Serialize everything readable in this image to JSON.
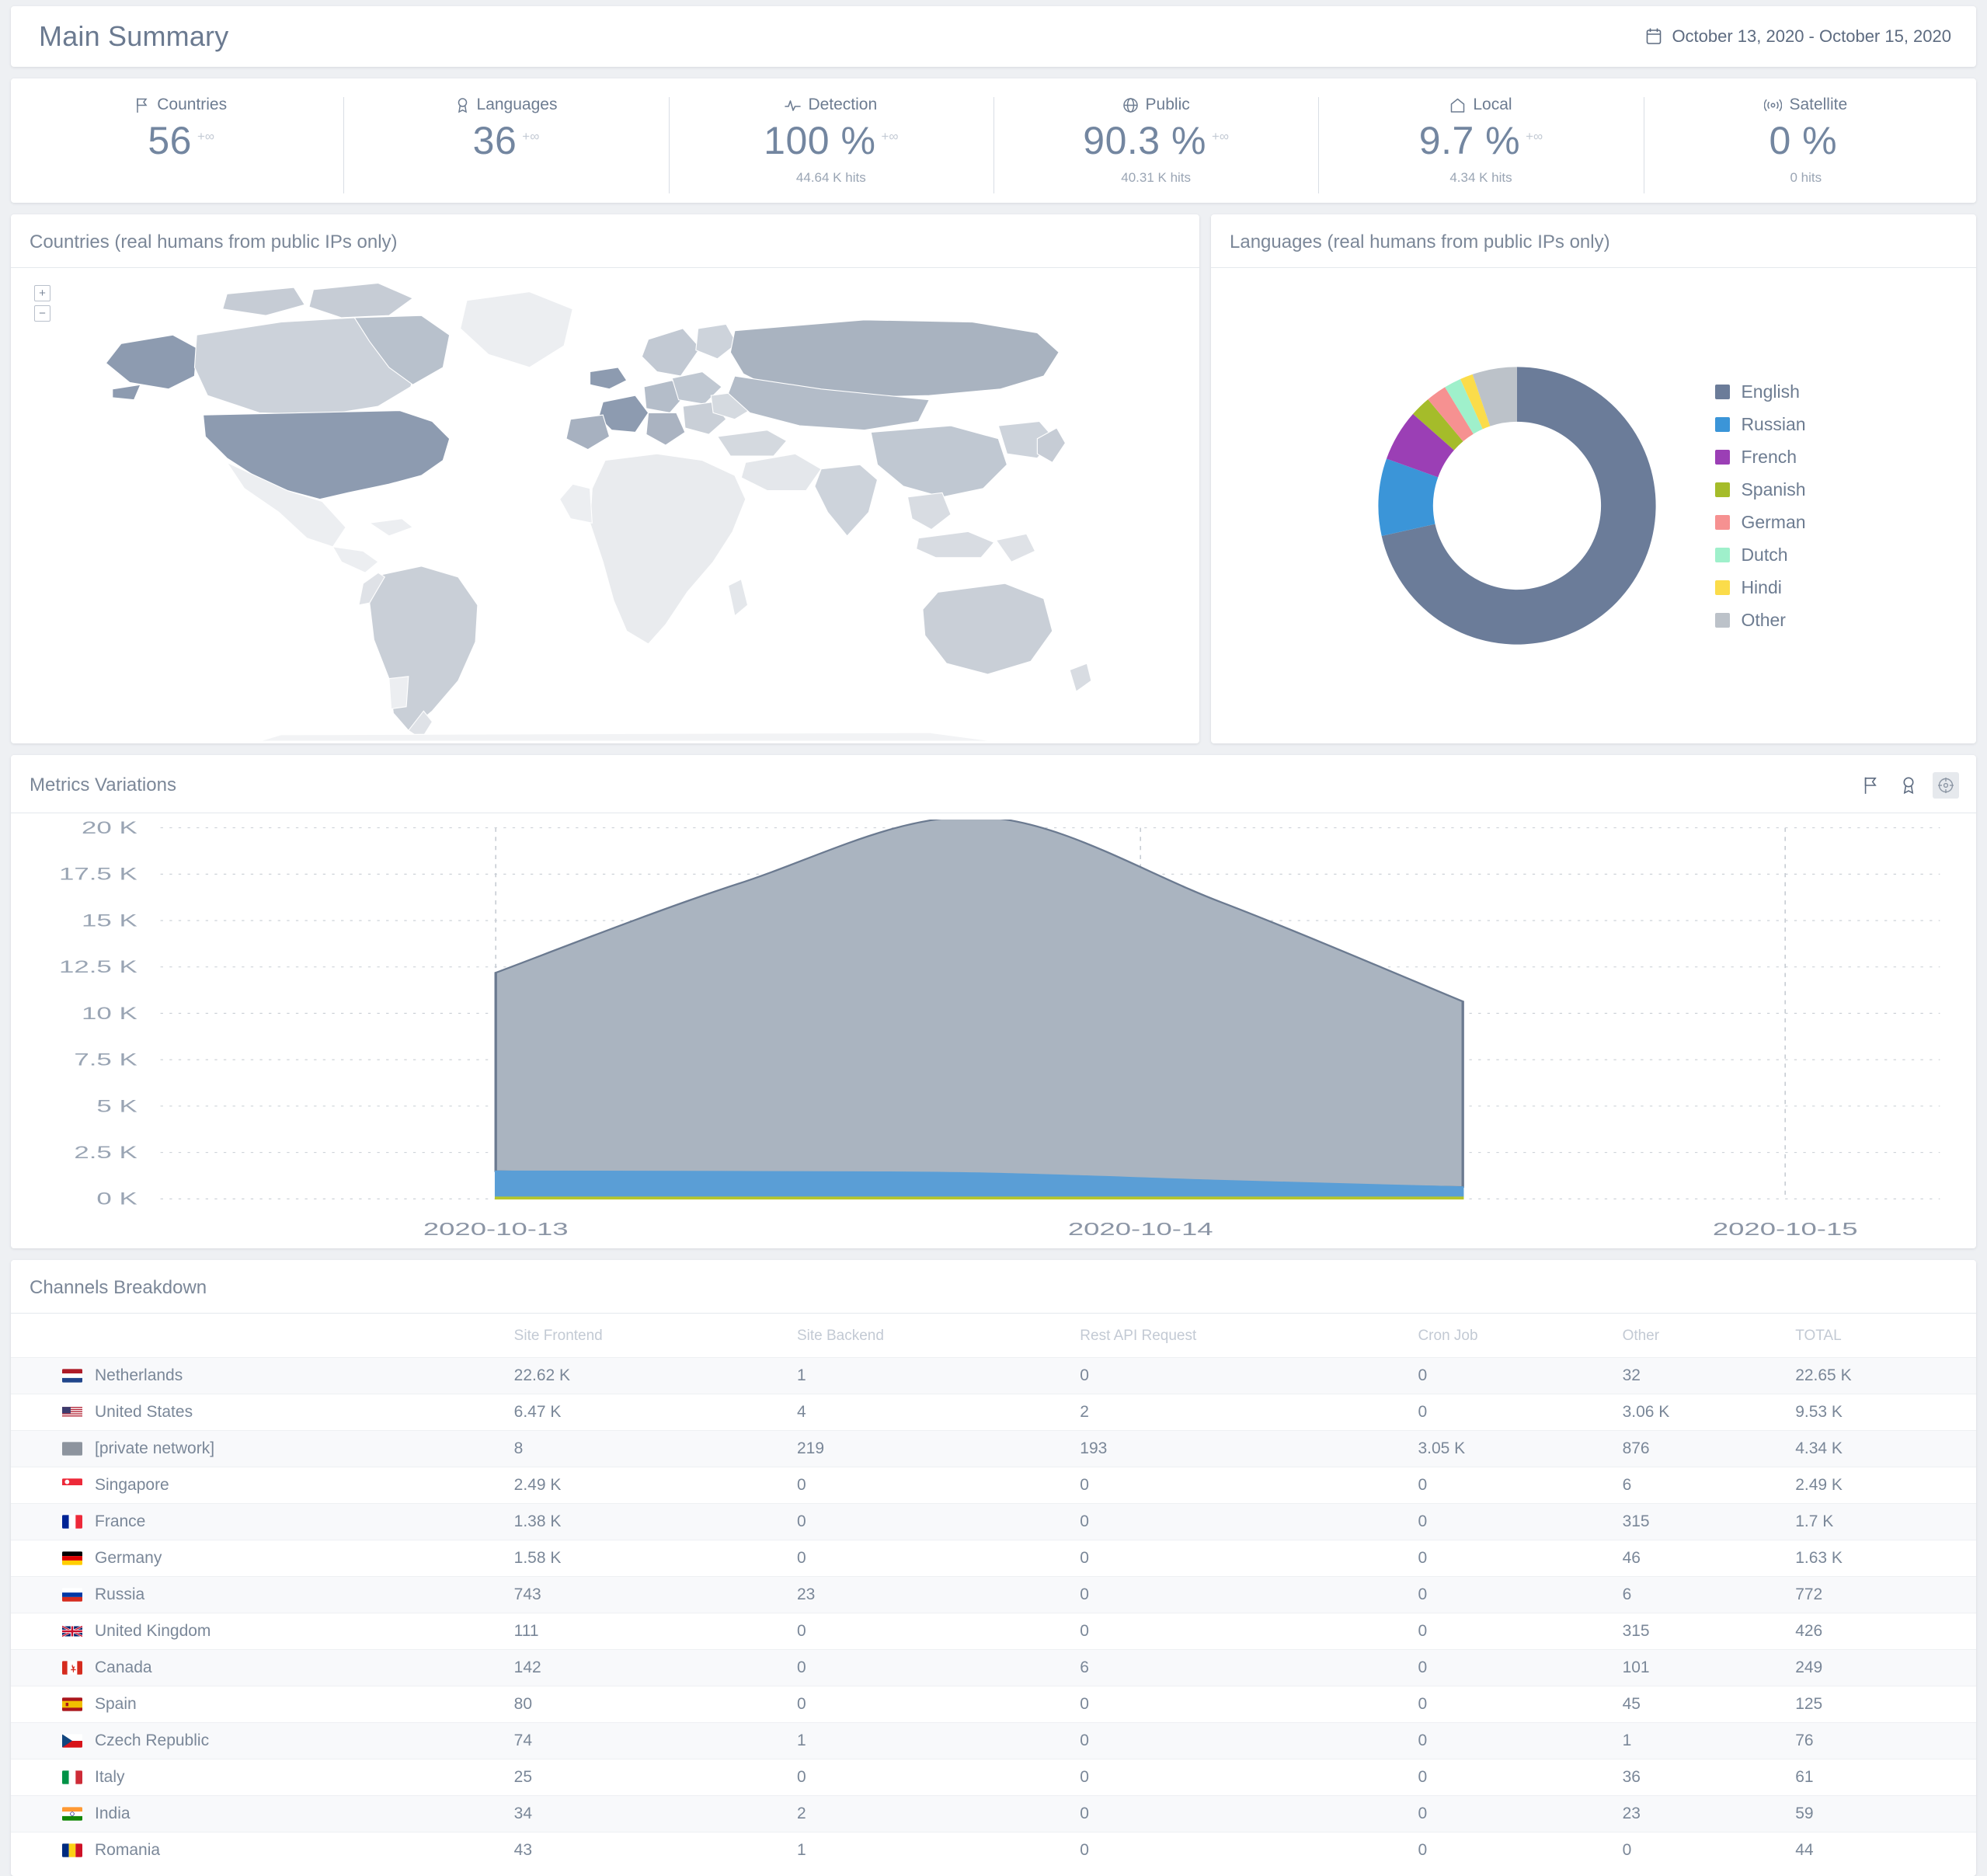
{
  "header": {
    "title": "Main Summary",
    "date_range": "October 13, 2020 - October 15, 2020",
    "calendar_icon": "calendar-icon"
  },
  "kpis": [
    {
      "icon": "flag-icon",
      "label": "Countries",
      "value": "56",
      "delta": "+∞",
      "sub": ""
    },
    {
      "icon": "award-icon",
      "label": "Languages",
      "value": "36",
      "delta": "+∞",
      "sub": ""
    },
    {
      "icon": "activity-icon",
      "label": "Detection",
      "value": "100 %",
      "delta": "+∞",
      "sub": "44.64 K hits"
    },
    {
      "icon": "globe-icon",
      "label": "Public",
      "value": "90.3 %",
      "delta": "+∞",
      "sub": "40.31 K hits"
    },
    {
      "icon": "home-icon",
      "label": "Local",
      "value": "9.7 %",
      "delta": "+∞",
      "sub": "4.34 K hits"
    },
    {
      "icon": "satellite-icon",
      "label": "Satellite",
      "value": "0 %",
      "delta": "",
      "sub": "0  hits"
    }
  ],
  "map_panel": {
    "title": "Countries (real humans from public IPs only)",
    "zoom_in_label": "+",
    "zoom_out_label": "−"
  },
  "languages_panel": {
    "title": "Languages (real humans from public IPs only)"
  },
  "metrics_panel": {
    "title": "Metrics Variations",
    "tools": [
      {
        "name": "flag-icon",
        "active": false
      },
      {
        "name": "award-icon",
        "active": false
      },
      {
        "name": "target-icon",
        "active": true
      }
    ]
  },
  "table_panel": {
    "title": "Channels Breakdown",
    "columns": [
      "",
      "Site Frontend",
      "Site Backend",
      "Rest API Request",
      "Cron Job",
      "Other",
      "TOTAL"
    ],
    "rows": [
      {
        "country": "Netherlands",
        "flag": "nl",
        "site_frontend": "22.62 K",
        "site_backend": "1",
        "rest_api": "0",
        "cron_job": "0",
        "other": "32",
        "total": "22.65 K"
      },
      {
        "country": "United States",
        "flag": "us",
        "site_frontend": "6.47 K",
        "site_backend": "4",
        "rest_api": "2",
        "cron_job": "0",
        "other": "3.06 K",
        "total": "9.53 K"
      },
      {
        "country": "[private network]",
        "flag": "private",
        "site_frontend": "8",
        "site_backend": "219",
        "rest_api": "193",
        "cron_job": "3.05 K",
        "other": "876",
        "total": "4.34 K"
      },
      {
        "country": "Singapore",
        "flag": "sg",
        "site_frontend": "2.49 K",
        "site_backend": "0",
        "rest_api": "0",
        "cron_job": "0",
        "other": "6",
        "total": "2.49 K"
      },
      {
        "country": "France",
        "flag": "fr",
        "site_frontend": "1.38 K",
        "site_backend": "0",
        "rest_api": "0",
        "cron_job": "0",
        "other": "315",
        "total": "1.7 K"
      },
      {
        "country": "Germany",
        "flag": "de",
        "site_frontend": "1.58 K",
        "site_backend": "0",
        "rest_api": "0",
        "cron_job": "0",
        "other": "46",
        "total": "1.63 K"
      },
      {
        "country": "Russia",
        "flag": "ru",
        "site_frontend": "743",
        "site_backend": "23",
        "rest_api": "0",
        "cron_job": "0",
        "other": "6",
        "total": "772"
      },
      {
        "country": "United Kingdom",
        "flag": "gb",
        "site_frontend": "111",
        "site_backend": "0",
        "rest_api": "0",
        "cron_job": "0",
        "other": "315",
        "total": "426"
      },
      {
        "country": "Canada",
        "flag": "ca",
        "site_frontend": "142",
        "site_backend": "0",
        "rest_api": "6",
        "cron_job": "0",
        "other": "101",
        "total": "249"
      },
      {
        "country": "Spain",
        "flag": "es",
        "site_frontend": "80",
        "site_backend": "0",
        "rest_api": "0",
        "cron_job": "0",
        "other": "45",
        "total": "125"
      },
      {
        "country": "Czech Republic",
        "flag": "cz",
        "site_frontend": "74",
        "site_backend": "1",
        "rest_api": "0",
        "cron_job": "0",
        "other": "1",
        "total": "76"
      },
      {
        "country": "Italy",
        "flag": "it",
        "site_frontend": "25",
        "site_backend": "0",
        "rest_api": "0",
        "cron_job": "0",
        "other": "36",
        "total": "61"
      },
      {
        "country": "India",
        "flag": "in",
        "site_frontend": "34",
        "site_backend": "2",
        "rest_api": "0",
        "cron_job": "0",
        "other": "23",
        "total": "59"
      },
      {
        "country": "Romania",
        "flag": "ro",
        "site_frontend": "43",
        "site_backend": "1",
        "rest_api": "0",
        "cron_job": "0",
        "other": "0",
        "total": "44"
      }
    ]
  },
  "chart_data": [
    {
      "type": "pie",
      "title": "Languages (real humans from public IPs only)",
      "legend_position": "right",
      "categories": [
        "English",
        "Russian",
        "French",
        "Spanish",
        "German",
        "Dutch",
        "Hindi",
        "Other"
      ],
      "values": [
        71.5,
        9.0,
        6.0,
        2.4,
        2.4,
        2.0,
        1.5,
        5.2
      ],
      "colors": [
        "#6b7c99",
        "#3b95d8",
        "#9b3fb5",
        "#a5bc2a",
        "#f69191",
        "#9ff0cb",
        "#fbdc4a",
        "#bcc2c9"
      ]
    },
    {
      "type": "area",
      "title": "Metrics Variations",
      "xlabel": "",
      "ylabel": "",
      "ylim": [
        0,
        20000
      ],
      "yticks": [
        "0 K",
        "2.5 K",
        "5 K",
        "7.5 K",
        "10 K",
        "12.5 K",
        "15 K",
        "17.5 K",
        "20 K"
      ],
      "xticks": [
        "2020-10-13",
        "2020-10-14",
        "2020-10-15"
      ],
      "grid": true,
      "x": [
        "2020-10-13",
        "2020-10-13T12",
        "2020-10-14",
        "2020-10-14T12",
        "2020-10-15"
      ],
      "series": [
        {
          "name": "public",
          "color": "#aab4c0",
          "values": [
            10700,
            15500,
            19200,
            15000,
            10000
          ]
        },
        {
          "name": "local",
          "color": "#5a9ed6",
          "values": [
            1400,
            1380,
            1300,
            900,
            550
          ]
        },
        {
          "name": "satellite",
          "color": "#b5c62c",
          "values": [
            90,
            90,
            90,
            90,
            90
          ]
        }
      ]
    },
    {
      "type": "heatmap",
      "title": "Countries (real humans from public IPs only)",
      "note": "world choropleth map, gray-blue scale"
    }
  ]
}
